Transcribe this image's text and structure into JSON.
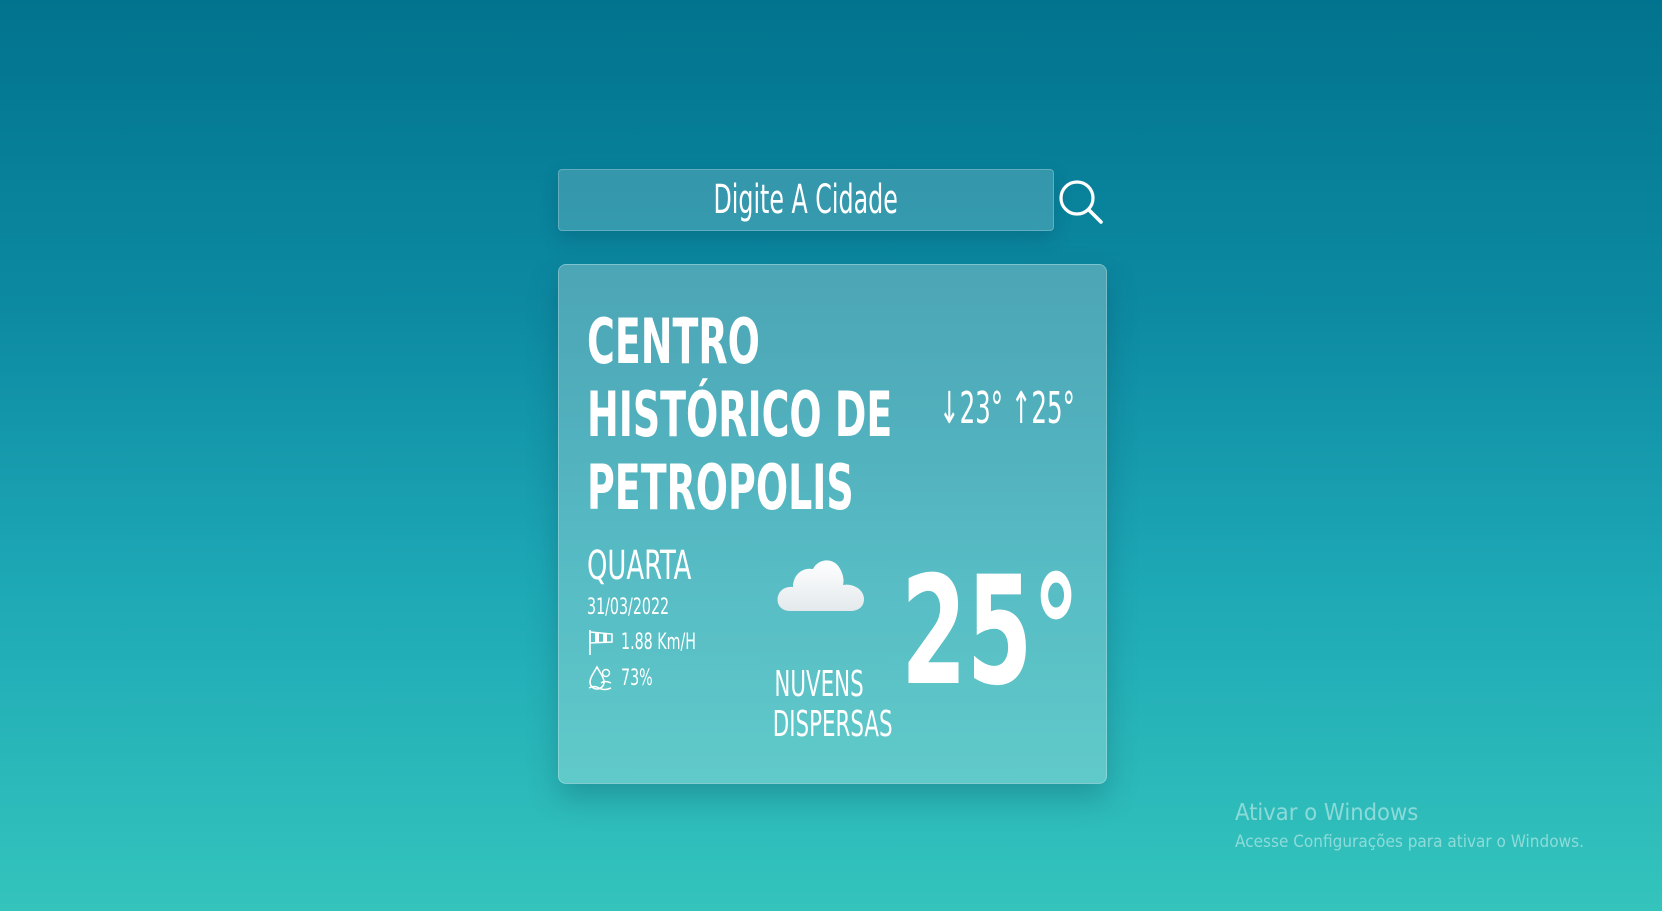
{
  "search": {
    "placeholder": "Digite A Cidade",
    "button_icon": "search-icon"
  },
  "weather": {
    "city_lines": [
      "CENTRO",
      "HISTÓRICO DE",
      "PETROPOLIS"
    ],
    "min_arrow": "↓",
    "min_temp": "23°",
    "max_arrow": "↑",
    "max_temp": "25°",
    "day": "QUARTA",
    "date": "31/03/2022",
    "wind_icon": "windsock-icon",
    "wind": "1.88 Km/H",
    "humidity_icon": "humidity-icon",
    "humidity": "73%",
    "condition_icon": "cloud-icon",
    "description_lines": [
      "NUVENS",
      "DISPERSAS"
    ],
    "temperature": "25°"
  },
  "watermark": {
    "title": "Ativar o Windows",
    "subtitle": "Acesse Configurações para ativar o Windows."
  },
  "colors": {
    "background_top": "#02738e",
    "background_bottom": "#34c4bc",
    "text": "#ffffff"
  }
}
